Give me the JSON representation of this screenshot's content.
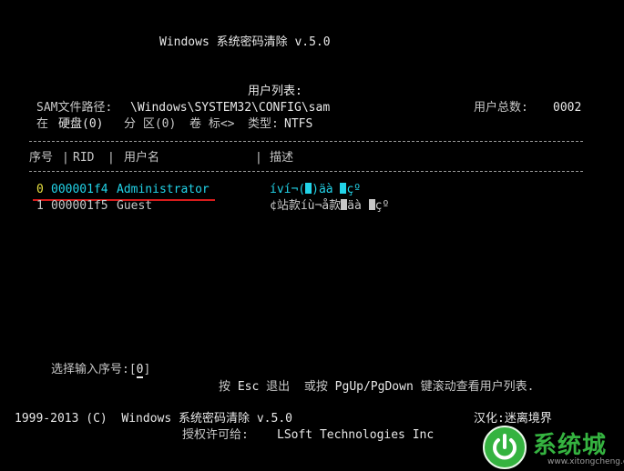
{
  "header": {
    "title": "Windows 系统密码清除 v.5.0"
  },
  "sam": {
    "list_title": "用户列表:",
    "path_label": "SAM文件路径:",
    "path_value": "\\Windows\\SYSTEM32\\CONFIG\\sam",
    "total_label": "用户总数:",
    "total_value": "0002",
    "loc_label_in": "在",
    "loc_disk": "硬盘(0)",
    "loc_part_label": "分 区(0)",
    "loc_vol_label": "卷 标<>",
    "loc_type_label": "类型:",
    "loc_type_value": "NTFS"
  },
  "table": {
    "columns": [
      "序号",
      "RID",
      "用户名",
      "描述"
    ],
    "rows": [
      {
        "index": "0",
        "rid": "000001f4",
        "name": "Administrator",
        "desc_a": "íví¬(",
        "desc_b": ")äà ",
        "desc_c": "çº"
      },
      {
        "index": "1",
        "rid": "000001f5",
        "name": "Guest",
        "desc_a": "¢站款íù¬å款",
        "desc_b": "äà ",
        "desc_c": "çº"
      }
    ]
  },
  "prompt": {
    "label": "选择输入序号:[",
    "value": "0",
    "close": "]"
  },
  "help": {
    "press": "按",
    "esc": "Esc",
    "exit": "退出",
    "or_press": "或按",
    "keys": "PgUp/PgDown",
    "scroll": "键滚动查看用户列表."
  },
  "footer": {
    "copyright": "1999-2013 (C)  Windows 系统密码清除 v.5.0",
    "licensed_label": "授权许可给:",
    "licensed_value": "LSoft Technologies Inc",
    "localized": "汉化:迷离境界"
  },
  "watermark": {
    "text": "系统城",
    "url": "www.xitongcheng.com"
  },
  "colors": {
    "background": "#000000",
    "text": "#c8c8c8",
    "highlight": "#22d3e8",
    "accent_red": "#d81c1c"
  }
}
